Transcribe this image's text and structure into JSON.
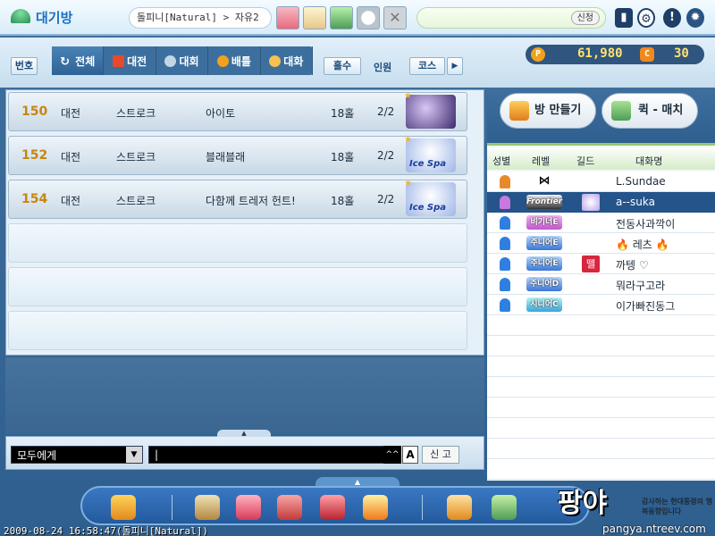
{
  "header": {
    "title": "대기방",
    "location": "돌피니[Natural] > 자유2",
    "message_button": "신청"
  },
  "filters": {
    "num_label": "번호",
    "tabs": [
      {
        "label": "전체",
        "icon": "refresh-icon"
      },
      {
        "label": "대전",
        "icon": "vs-icon"
      },
      {
        "label": "대회",
        "icon": "tournament-icon"
      },
      {
        "label": "배틀",
        "icon": "battle-icon"
      },
      {
        "label": "대화",
        "icon": "chat-icon"
      }
    ],
    "holes_label": "홀수",
    "people_label": "인원",
    "course_label": "코스",
    "next_arrow": "▶"
  },
  "currency": {
    "pang_icon": "P",
    "pang": "61,980",
    "cookie_icon": "C",
    "cookie": "30"
  },
  "rooms": [
    {
      "num": "150",
      "mode": "대전",
      "type": "스트로크",
      "name": "아이토",
      "holes": "18홀",
      "players": "2/2",
      "course": "dark",
      "course_label": ""
    },
    {
      "num": "152",
      "mode": "대전",
      "type": "스트로크",
      "name": "블래블래",
      "holes": "18홀",
      "players": "2/2",
      "course": "ice",
      "course_label": "Ice Spa"
    },
    {
      "num": "154",
      "mode": "대전",
      "type": "스트로크",
      "name": "다함께 트레저 헌트!",
      "holes": "18홀",
      "players": "2/2",
      "course": "ice",
      "course_label": "Ice Spa"
    }
  ],
  "chat": {
    "target": "모두에게",
    "input_value": "|",
    "ime_label": "^^",
    "font_label": "A",
    "report_label": "신 고",
    "dropdown_arrow": "▼",
    "handle_arrow": "▲"
  },
  "panel": {
    "create_room": "방 만들기",
    "quick_match": "퀵 - 매치",
    "headers": {
      "gender": "성별",
      "level": "레벨",
      "guild": "길드",
      "nickname": "대화명"
    }
  },
  "players": [
    {
      "gender": "female",
      "level_badge": "⋈",
      "level_style": "bow",
      "guild": "",
      "nickname": "L.Sundae",
      "selected": false
    },
    {
      "gender": "mic",
      "level_badge": "Frontier",
      "level_style": "frontier",
      "guild": "anim",
      "nickname": "a--suka",
      "selected": true
    },
    {
      "gender": "male",
      "level_badge": "비기너E",
      "level_style": "purple",
      "guild": "",
      "nickname": "전동사과깍이",
      "selected": false
    },
    {
      "gender": "male",
      "level_badge": "주니어E",
      "level_style": "blue",
      "guild": "",
      "nickname": "🔥 레츠 🔥",
      "selected": false
    },
    {
      "gender": "male",
      "level_badge": "주니어E",
      "level_style": "blue",
      "guild": "red",
      "guild_text": "뗄",
      "nickname": "까텡 ♡",
      "selected": false
    },
    {
      "gender": "male",
      "level_badge": "주니어D",
      "level_style": "blue",
      "guild": "",
      "nickname": "뭐라구고라",
      "selected": false
    },
    {
      "gender": "male",
      "level_badge": "시니어C",
      "level_style": "cyan",
      "guild": "",
      "nickname": "이가빠진동그",
      "selected": false
    }
  ],
  "dock": {
    "handle_arrow": "▲"
  },
  "brand": {
    "logo": "팡야",
    "slogan": "감사하는 현대통령의 행복동향입니다",
    "url": "pangya.ntreev.com"
  },
  "status": {
    "timestamp": "2009-08-24 16:58:47(돌피니[Natural])"
  }
}
